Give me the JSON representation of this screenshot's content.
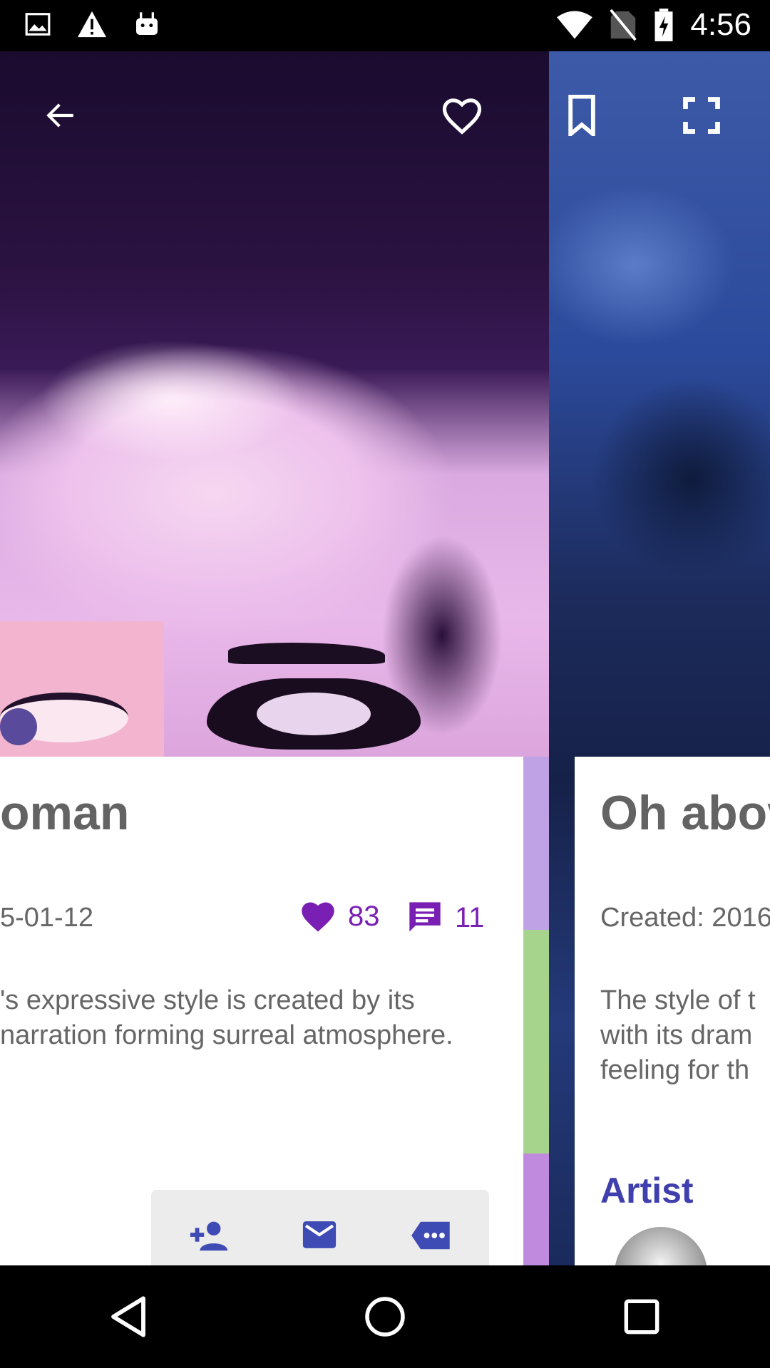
{
  "status_bar": {
    "time": "4:56",
    "left_icons": [
      "image-icon",
      "warning-icon",
      "android-icon"
    ],
    "right_icons": [
      "wifi-icon",
      "no-sim-icon",
      "battery-charging-icon"
    ]
  },
  "toolbar": {
    "back_icon": "arrow-back-icon",
    "favorite_icon": "heart-outline-icon",
    "bookmark_icon": "bookmark-outline-icon",
    "fullscreen_icon": "fullscreen-icon"
  },
  "left_card": {
    "title": "oman",
    "date": "5-01-12",
    "likes": "83",
    "comments": "11",
    "description_lines": [
      "'s expressive style is created by its",
      "narration forming surreal atmosphere."
    ],
    "actions": [
      "person-add-icon",
      "mail-icon",
      "message-icon"
    ]
  },
  "right_card": {
    "title": "Oh abov",
    "date": "Created: 2016",
    "description_lines": [
      "The style of t",
      "with its dram",
      "feeling for th"
    ],
    "artist_heading": "Artist"
  },
  "colors": {
    "accent_purple": "#7a1fb4",
    "artist_blue": "#3f3fad",
    "text_gray": "#666666"
  },
  "nav_bar": {
    "icons": [
      "back-triangle-icon",
      "home-circle-icon",
      "recents-square-icon"
    ]
  }
}
